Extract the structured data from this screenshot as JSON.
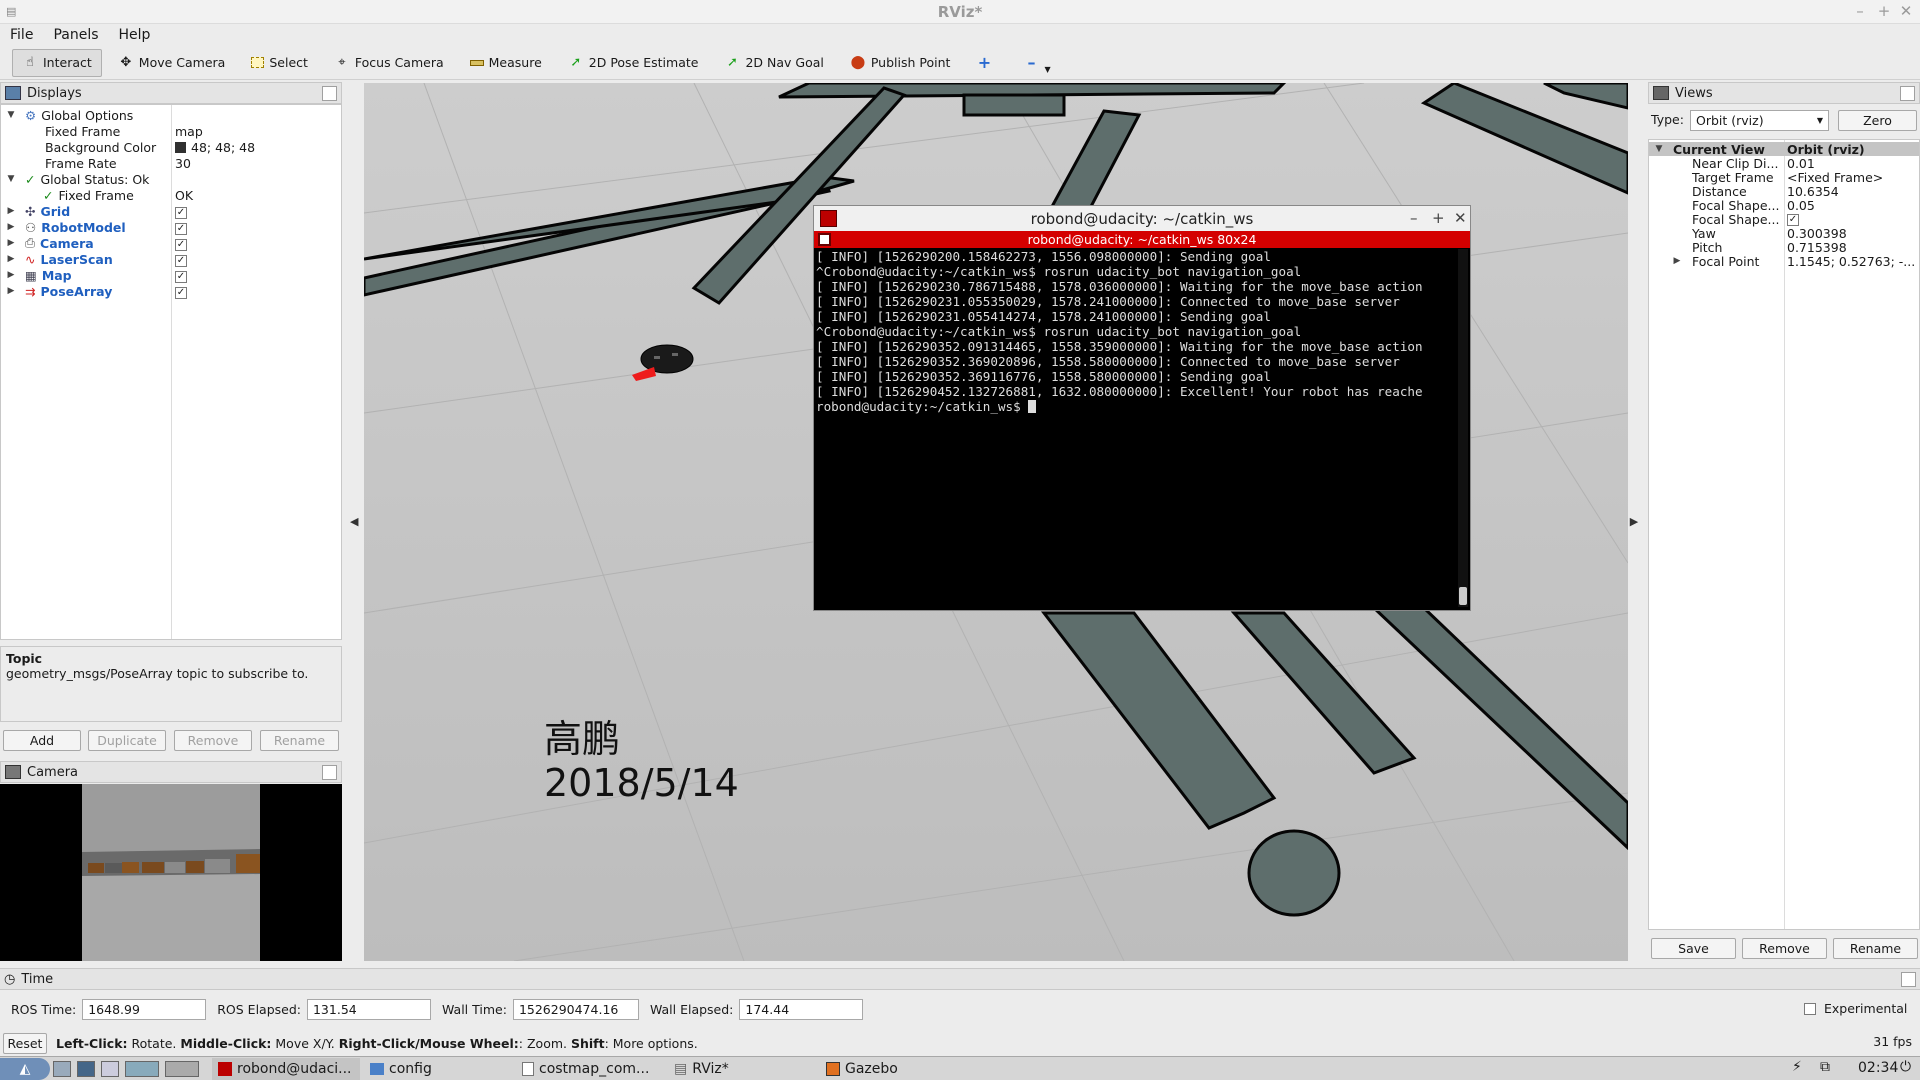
{
  "window": {
    "title": "RViz*"
  },
  "menu": [
    "File",
    "Panels",
    "Help"
  ],
  "toolbar": {
    "interact": "Interact",
    "move_camera": "Move Camera",
    "select": "Select",
    "focus_camera": "Focus Camera",
    "measure": "Measure",
    "pose_estimate": "2D Pose Estimate",
    "nav_goal": "2D Nav Goal",
    "publish_point": "Publish Point"
  },
  "displays": {
    "title": "Displays",
    "global_options": "Global Options",
    "fixed_frame_label": "Fixed Frame",
    "fixed_frame_value": "map",
    "bg_color_label": "Background Color",
    "bg_color_value": "48; 48; 48",
    "bg_color_hex": "#303030",
    "frame_rate_label": "Frame Rate",
    "frame_rate_value": "30",
    "global_status": "Global Status: Ok",
    "status_fixed_frame": "Fixed Frame",
    "status_fixed_value": "OK",
    "items": [
      "Grid",
      "RobotModel",
      "Camera",
      "LaserScan",
      "Map",
      "PoseArray"
    ]
  },
  "help": {
    "title": "Topic",
    "text": "geometry_msgs/PoseArray topic to subscribe to."
  },
  "display_buttons": {
    "add": "Add",
    "duplicate": "Duplicate",
    "remove": "Remove",
    "rename": "Rename"
  },
  "camera_panel": {
    "title": "Camera"
  },
  "overlay": {
    "name": "高鹏",
    "date": "2018/5/14"
  },
  "terminal": {
    "title": "robond@udacity: ~/catkin_ws",
    "tab": "robond@udacity: ~/catkin_ws 80x24",
    "lines": [
      "[ INFO] [1526290200.158462273, 1556.098000000]: Sending goal",
      "^Crobond@udacity:~/catkin_ws$ rosrun udacity_bot navigation_goal",
      "[ INFO] [1526290230.786715488, 1578.036000000]: Waiting for the move_base action",
      "[ INFO] [1526290231.055350029, 1578.241000000]: Connected to move_base server",
      "[ INFO] [1526290231.055414274, 1578.241000000]: Sending goal",
      "^Crobond@udacity:~/catkin_ws$ rosrun udacity_bot navigation_goal",
      "[ INFO] [1526290352.091314465, 1558.359000000]: Waiting for the move_base action",
      "[ INFO] [1526290352.369020896, 1558.580000000]: Connected to move_base server",
      "[ INFO] [1526290352.369116776, 1558.580000000]: Sending goal",
      "[ INFO] [1526290452.132726881, 1632.080000000]: Excellent! Your robot has reache"
    ],
    "prompt": "robond@udacity:~/catkin_ws$ "
  },
  "views": {
    "title": "Views",
    "type_label": "Type:",
    "type_value": "Orbit (rviz)",
    "zero": "Zero",
    "current_view": "Current View",
    "current_view_value": "Orbit (rviz)",
    "props": [
      {
        "label": "Near Clip Di...",
        "value": "0.01"
      },
      {
        "label": "Target Frame",
        "value": "<Fixed Frame>"
      },
      {
        "label": "Distance",
        "value": "10.6354"
      },
      {
        "label": "Focal Shape...",
        "value": "0.05"
      },
      {
        "label": "Focal Shape...",
        "value": "✓"
      },
      {
        "label": "Yaw",
        "value": "0.300398"
      },
      {
        "label": "Pitch",
        "value": "0.715398"
      },
      {
        "label": "Focal Point",
        "value": "1.1545; 0.52763; -..."
      }
    ],
    "save": "Save",
    "remove": "Remove",
    "rename": "Rename"
  },
  "time": {
    "title": "Time",
    "ros_time_label": "ROS Time:",
    "ros_time": "1648.99",
    "ros_elapsed_label": "ROS Elapsed:",
    "ros_elapsed": "131.54",
    "wall_time_label": "Wall Time:",
    "wall_time": "1526290474.16",
    "wall_elapsed_label": "Wall Elapsed:",
    "wall_elapsed": "174.44",
    "experimental": "Experimental"
  },
  "status": {
    "reset": "Reset",
    "lc": "Left-Click:",
    "lc_t": " Rotate. ",
    "mc": "Middle-Click:",
    "mc_t": " Move X/Y. ",
    "rc": "Right-Click/Mouse Wheel:",
    "rc_t": ": Zoom. ",
    "sh": "Shift",
    "sh_t": ": More options.",
    "fps": "31 fps"
  },
  "taskbar": {
    "items": [
      "robond@udaci...",
      "config",
      "costmap_com...",
      "RViz*",
      "Gazebo"
    ],
    "clock": "02:34"
  }
}
